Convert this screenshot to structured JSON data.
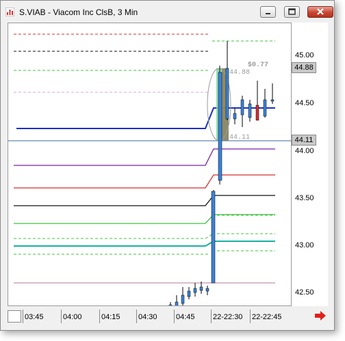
{
  "window": {
    "title": "S.VIAB - Viacom Inc ClsB, 3 Min",
    "controls": [
      "minimize-icon",
      "restore-icon",
      "close-icon"
    ]
  },
  "price_axis": {
    "labels": [
      "45.00",
      "44.50",
      "44.00",
      "43.50",
      "43.00",
      "42.50"
    ],
    "current_price": "44.88",
    "reference_price": "44.11"
  },
  "time_axis": {
    "labels": [
      "03:45",
      "04:00",
      "04:15",
      "04:30",
      "04:45",
      "22-22:30",
      "22-22:45"
    ]
  },
  "annotations": {
    "change": "$0.77",
    "high": "44.88",
    "low": "44.11"
  },
  "colors": {
    "up_candle": "#3b82d8",
    "down_candle": "#d32f2f",
    "blue_level": "#1c2fc4",
    "highlight_green": "#7fd6a6",
    "highlight_brown": "#8a6a50",
    "nav_arrow": "#e0201a"
  }
}
